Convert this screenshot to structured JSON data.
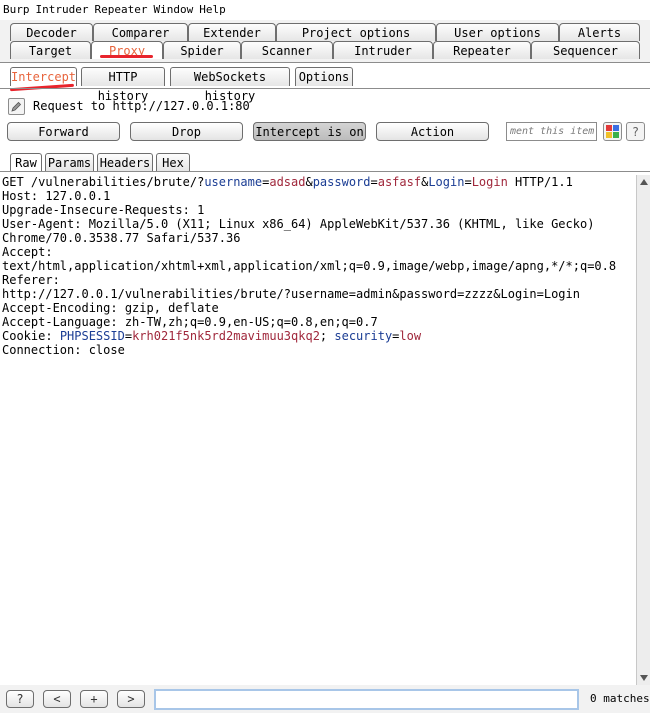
{
  "menu": [
    "Burp",
    "Intruder",
    "Repeater",
    "Window",
    "Help"
  ],
  "top_tabs": {
    "row1": [
      "Decoder",
      "Comparer",
      "Extender",
      "Project options",
      "User options",
      "Alerts"
    ],
    "row2": [
      "Target",
      "Proxy",
      "Spider",
      "Scanner",
      "Intruder",
      "Repeater",
      "Sequencer"
    ],
    "active": "Proxy"
  },
  "proxy_tabs": {
    "items": [
      "Intercept",
      "HTTP history",
      "WebSockets history",
      "Options"
    ],
    "active": "Intercept"
  },
  "request_label": "Request to http://127.0.0.1:80",
  "buttons": {
    "forward": "Forward",
    "drop": "Drop",
    "intercept": "Intercept is on",
    "action": "Action"
  },
  "comment_placeholder": "ment this item",
  "help_glyph": "?",
  "content_tabs": {
    "items": [
      "Raw",
      "Params",
      "Headers",
      "Hex"
    ],
    "active": "Raw"
  },
  "request": {
    "method": "GET",
    "path": "/vulnerabilities/brute/?",
    "params": [
      {
        "name": "username",
        "value": "adsad"
      },
      {
        "name": "password",
        "value": "asfasf"
      },
      {
        "name": "Login",
        "value": "Login"
      }
    ],
    "protocol": "HTTP/1.1",
    "lines": [
      "Host: 127.0.0.1",
      "Upgrade-Insecure-Requests: 1",
      "User-Agent: Mozilla/5.0 (X11; Linux x86_64) AppleWebKit/537.36 (KHTML, like Gecko)",
      "Chrome/70.0.3538.77 Safari/537.36",
      "Accept:",
      "text/html,application/xhtml+xml,application/xml;q=0.9,image/webp,image/apng,*/*;q=0.8",
      "Referer:",
      "http://127.0.0.1/vulnerabilities/brute/?username=admin&password=zzzz&Login=Login",
      "Accept-Encoding: gzip, deflate",
      "Accept-Language: zh-TW,zh;q=0.9,en-US;q=0.8,en;q=0.7"
    ],
    "cookie_label": "Cookie:",
    "cookies": [
      {
        "name": "PHPSESSID",
        "value": "krh021f5nk5rd2mavimuu3qkq2"
      },
      {
        "name": "security",
        "value": "low"
      }
    ],
    "last_line": "Connection: close"
  },
  "footer": {
    "help": "?",
    "prev": "<",
    "add": "+",
    "next": ">",
    "search_value": "",
    "matches": "0 matches"
  },
  "colors": {
    "param_name": "#1b3d94",
    "param_value": "#a0283c",
    "active_tab_text": "#e8643c",
    "annotation": "#e8242c"
  }
}
